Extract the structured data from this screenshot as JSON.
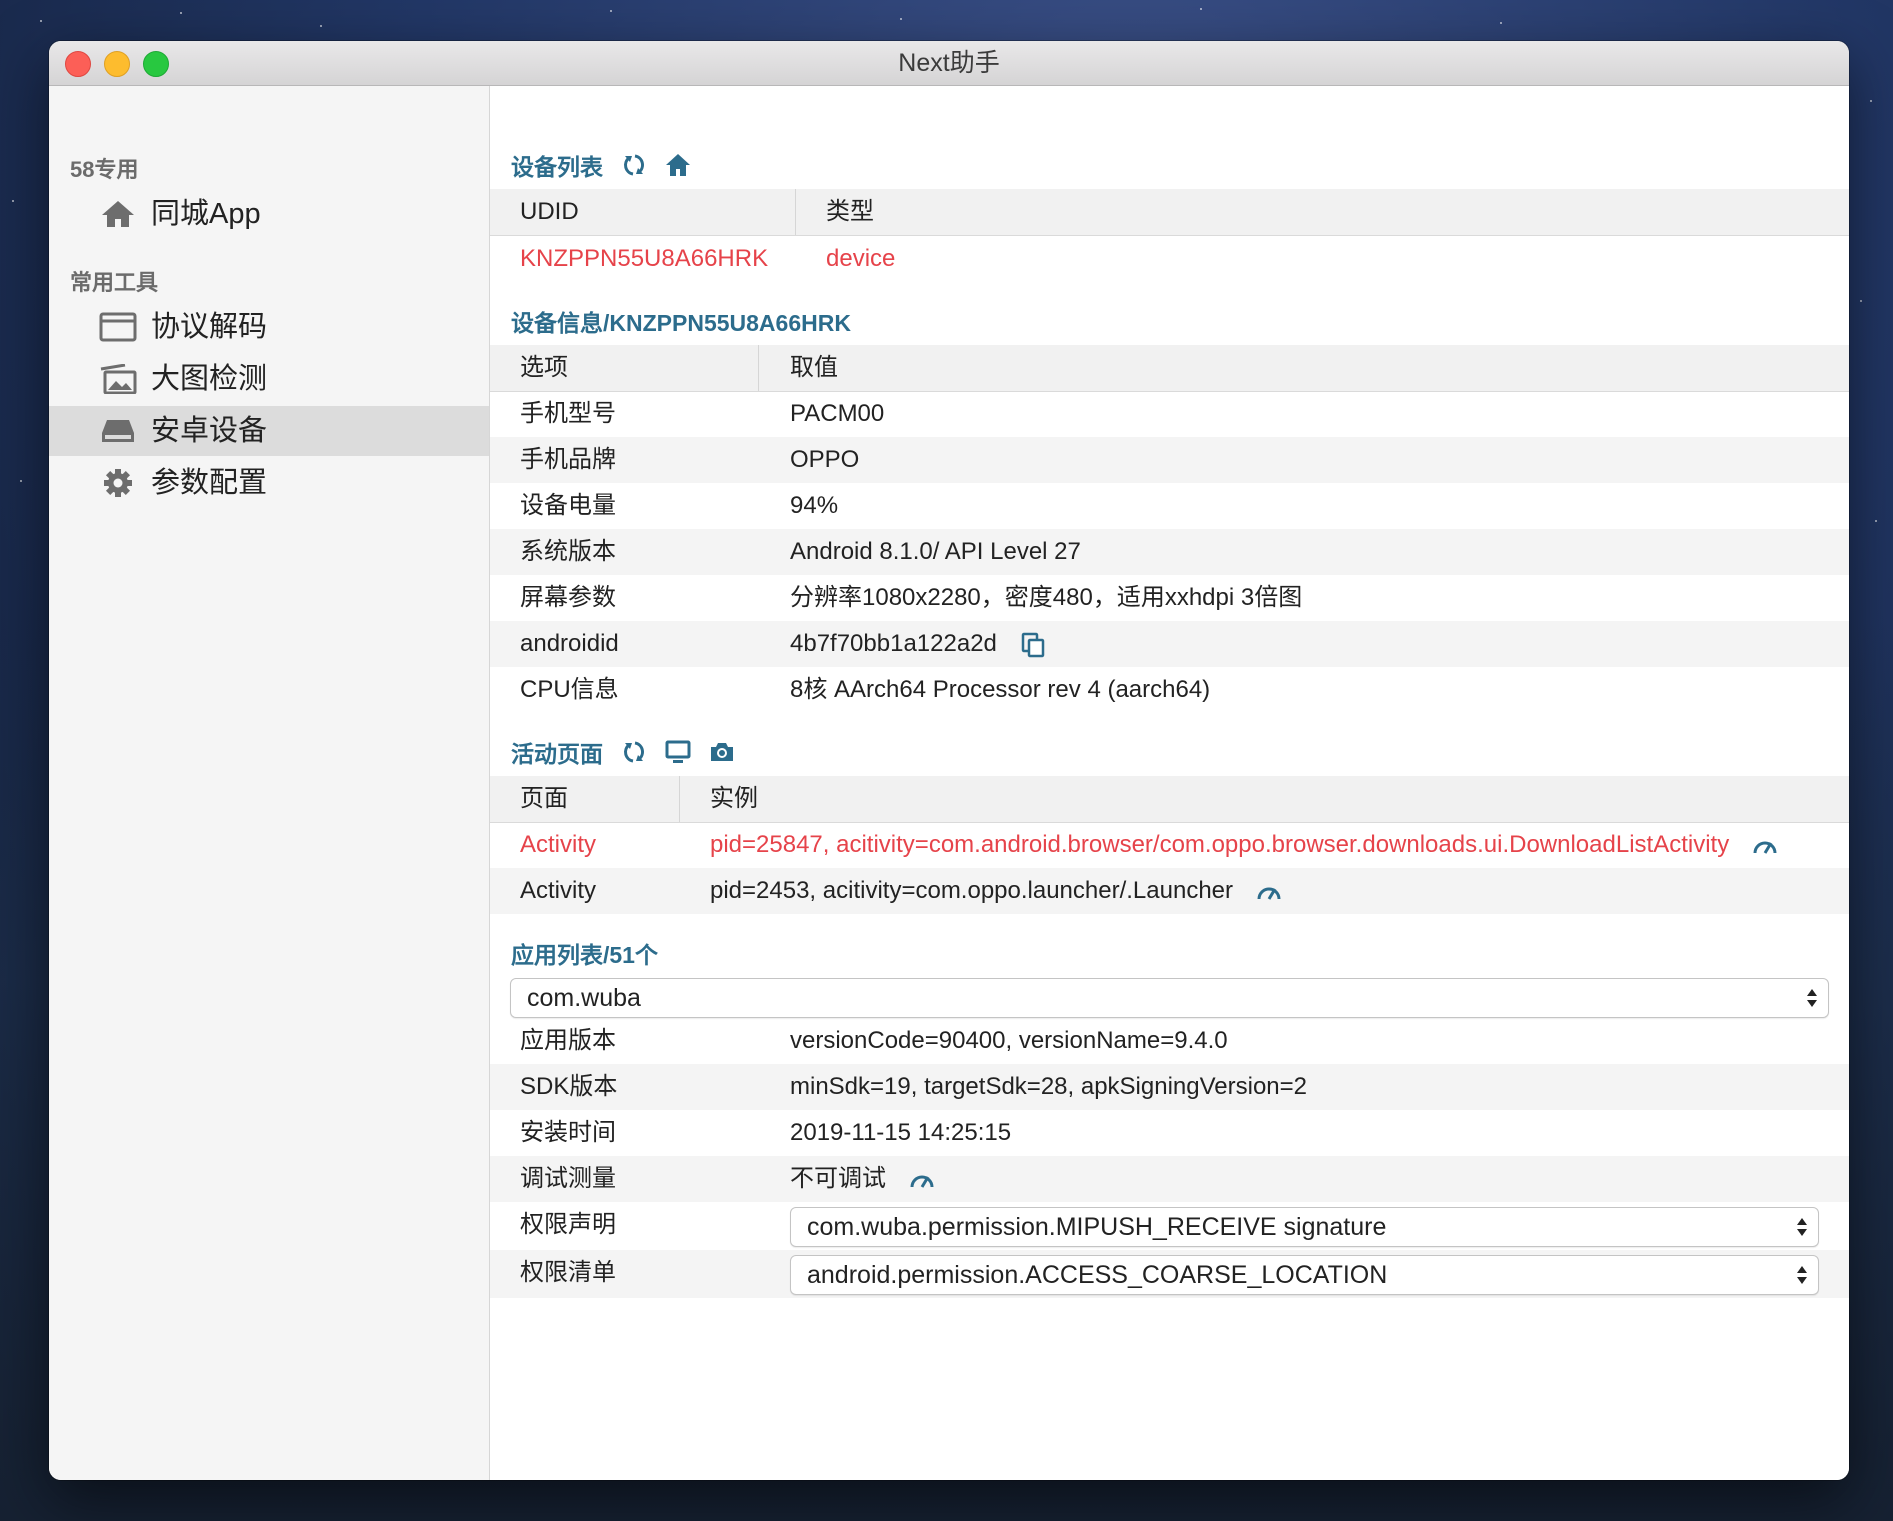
{
  "window": {
    "title": "Next助手"
  },
  "sidebar": {
    "sections": [
      {
        "title": "58专用",
        "items": [
          {
            "label": "同城App",
            "icon": "home-icon"
          }
        ]
      },
      {
        "title": "常用工具",
        "items": [
          {
            "label": "协议解码",
            "icon": "window-icon"
          },
          {
            "label": "大图检测",
            "icon": "image-icon"
          },
          {
            "label": "安卓设备",
            "icon": "drive-icon",
            "active": true
          },
          {
            "label": "参数配置",
            "icon": "gear-icon"
          }
        ]
      }
    ]
  },
  "device_list": {
    "title": "设备列表",
    "headers": [
      "UDID",
      "类型"
    ],
    "rows": [
      {
        "udid": "KNZPPN55U8A66HRK",
        "type": "device"
      }
    ]
  },
  "device_info": {
    "title": "设备信息/KNZPPN55U8A66HRK",
    "headers": [
      "选项",
      "取值"
    ],
    "rows": [
      {
        "key": "手机型号",
        "value": "PACM00"
      },
      {
        "key": "手机品牌",
        "value": "OPPO"
      },
      {
        "key": "设备电量",
        "value": "94%"
      },
      {
        "key": "系统版本",
        "value": "Android 8.1.0/ API Level 27"
      },
      {
        "key": "屏幕参数",
        "value": "分辨率1080x2280，密度480，适用xxhdpi 3倍图"
      },
      {
        "key": "androidid",
        "value": "4b7f70bb1a122a2d"
      },
      {
        "key": "CPU信息",
        "value": "8核 AArch64 Processor rev 4 (aarch64)"
      }
    ]
  },
  "activities": {
    "title": "活动页面",
    "headers": [
      "页面",
      "实例"
    ],
    "rows": [
      {
        "page": "Activity",
        "instance": "pid=25847, acitivity=com.android.browser/com.oppo.browser.downloads.ui.DownloadListActivity"
      },
      {
        "page": "Activity",
        "instance": "pid=2453, acitivity=com.oppo.launcher/.Launcher"
      }
    ]
  },
  "apps": {
    "title": "应用列表/51个",
    "selected": "com.wuba",
    "rows": [
      {
        "key": "应用版本",
        "value": "versionCode=90400, versionName=9.4.0"
      },
      {
        "key": "SDK版本",
        "value": "minSdk=19, targetSdk=28, apkSigningVersion=2"
      },
      {
        "key": "安装时间",
        "value": "2019-11-15 14:25:15"
      },
      {
        "key": "调试测量",
        "value": "不可调试"
      },
      {
        "key": "权限声明",
        "value": "com.wuba.permission.MIPUSH_RECEIVE signature"
      },
      {
        "key": "权限清单",
        "value": "android.permission.ACCESS_COARSE_LOCATION"
      }
    ]
  },
  "colors": {
    "accent": "#2c6c8c",
    "highlight": "#e6434a",
    "sidebar_active": "#dcdcdc"
  }
}
